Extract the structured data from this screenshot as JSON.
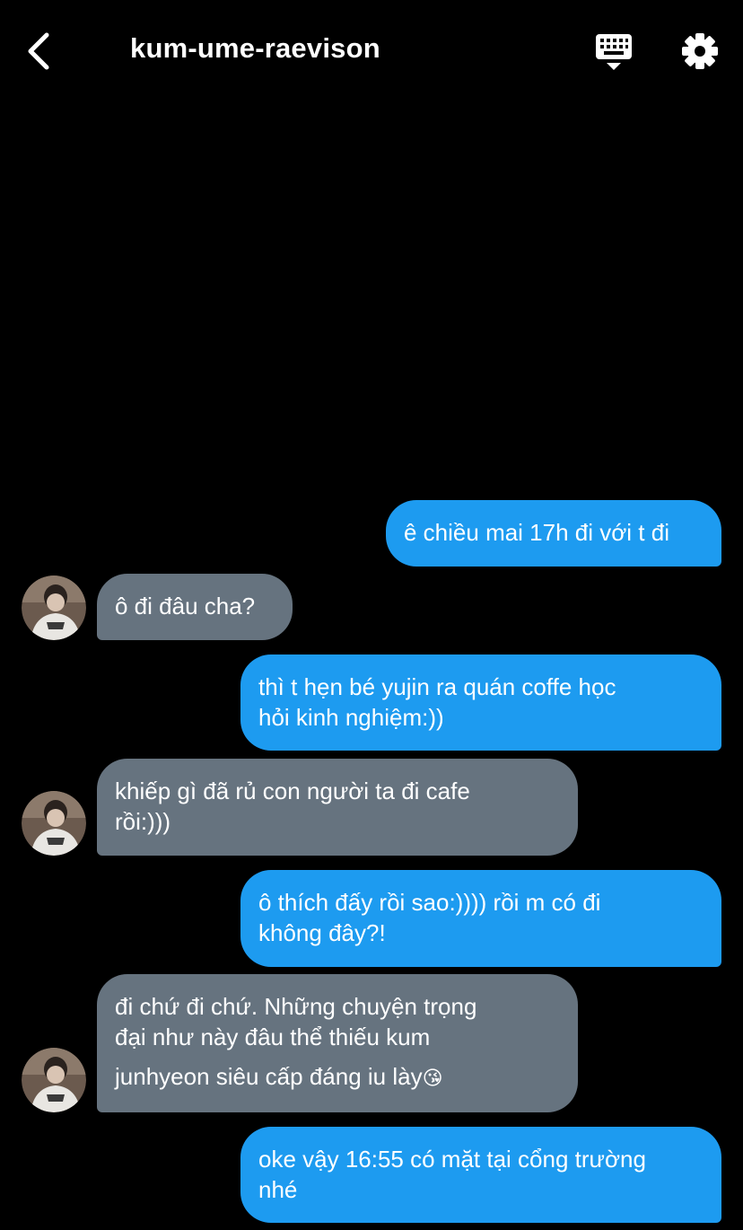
{
  "header": {
    "back_icon": "chevron-left-icon",
    "title": "kum-ume-raevison",
    "keyboard_icon": "keyboard-icon",
    "settings_icon": "gear-icon"
  },
  "colors": {
    "background": "#000000",
    "sent_bubble": "#1d9bf0",
    "received_bubble": "#66737f",
    "text": "#ffffff"
  },
  "messages": [
    {
      "direction": "sent",
      "lines": [
        "ê chiều mai 17h đi với t đi"
      ]
    },
    {
      "direction": "received",
      "lines": [
        "ô đi đâu cha?"
      ]
    },
    {
      "direction": "sent",
      "lines": [
        "thì t hẹn bé yujin ra quán coffe học",
        "hỏi kinh nghiệm:))"
      ]
    },
    {
      "direction": "received",
      "lines": [
        "khiếp gì đã rủ con người ta đi cafe",
        "rồi:)))"
      ]
    },
    {
      "direction": "sent",
      "lines": [
        "ô thích đấy rồi sao:)))) rồi m có đi",
        "không đây?!"
      ]
    },
    {
      "direction": "received",
      "lines": [
        "đi chứ đi chứ. Những chuyện trọng",
        "đại như này đâu thể thiếu kum",
        "junhyeon siêu cấp đáng iu lày"
      ],
      "emoji": "😘"
    },
    {
      "direction": "sent",
      "lines": [
        "oke vậy 16:55 có mặt tại cổng trường",
        "nhé"
      ]
    }
  ]
}
